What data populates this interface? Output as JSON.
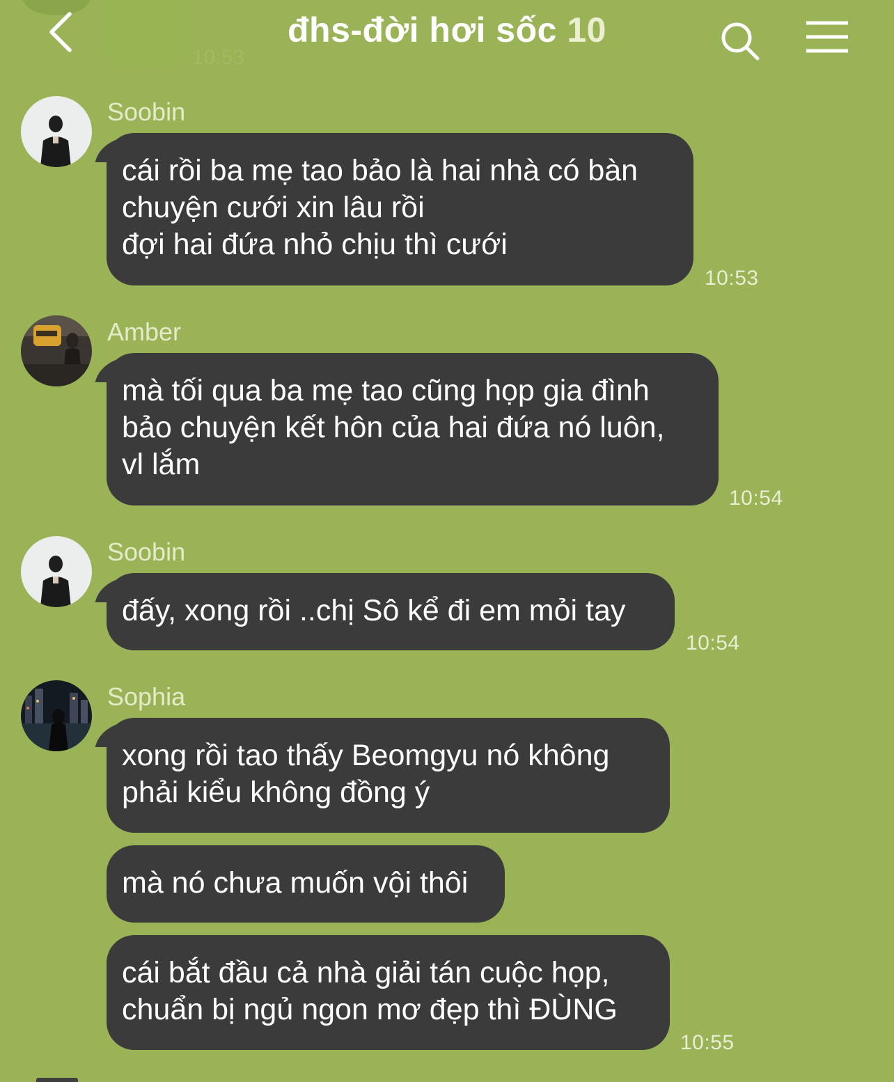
{
  "header": {
    "title": "đhs-đời hơi sốc",
    "member_count": "10"
  },
  "previous_message": {
    "time": "10:53"
  },
  "messages": [
    {
      "sender": "Soobin",
      "bubbles": [
        "cái rồi ba mẹ tao bảo là hai nhà có bàn\nchuyện cưới xin lâu rồi\nđợi hai đứa nhỏ chịu thì cưới"
      ],
      "time": "10:53"
    },
    {
      "sender": "Amber",
      "bubbles": [
        "mà tối qua ba mẹ tao cũng họp gia đình\nbảo chuyện kết hôn của hai đứa nó luôn,\nvl lắm"
      ],
      "time": "10:54"
    },
    {
      "sender": "Soobin",
      "bubbles": [
        "đấy, xong rồi ..chị Sô kể đi em mỏi tay"
      ],
      "time": "10:54"
    },
    {
      "sender": "Sophia",
      "bubbles": [
        "xong rồi tao thấy Beomgyu nó không\nphải kiểu không đồng ý",
        "mà nó chưa muốn vội thôi",
        "cái bắt đầu cả nhà giải tán cuộc họp,\nchuẩn bị ngủ ngon mơ đẹp thì ĐÙNG"
      ],
      "time": "10:55"
    }
  ],
  "colors": {
    "background": "#9bb357",
    "bubble": "#3b3b3b",
    "text": "#ffffff",
    "secondary_text": "#e4ebc9"
  },
  "icons": {
    "back": "chevron-left-icon",
    "search": "search-icon",
    "menu": "menu-icon"
  }
}
